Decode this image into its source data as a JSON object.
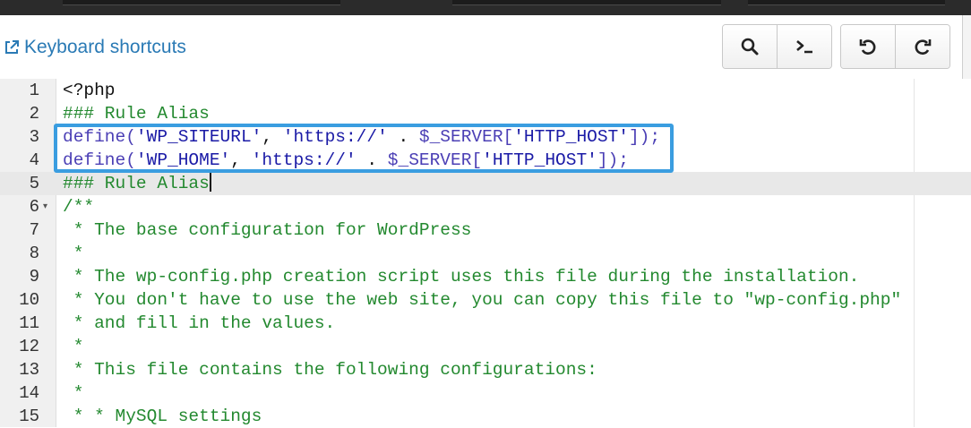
{
  "toolbar": {
    "keyboard_shortcuts_label": "Keyboard shortcuts",
    "icons": [
      "search-icon",
      "terminal-icon",
      "undo-icon",
      "redo-icon"
    ]
  },
  "editor": {
    "lines": [
      {
        "num": "1",
        "tokens": [
          {
            "t": "<?php",
            "c": "plain"
          }
        ]
      },
      {
        "num": "2",
        "tokens": [
          {
            "t": "### Rule Alias",
            "c": "comment"
          }
        ]
      },
      {
        "num": "3",
        "tokens": [
          {
            "t": "define(",
            "c": "kw"
          },
          {
            "t": "'WP_SITEURL'",
            "c": "str"
          },
          {
            "t": ", ",
            "c": "plain"
          },
          {
            "t": "'https://'",
            "c": "str"
          },
          {
            "t": " . ",
            "c": "plain"
          },
          {
            "t": "$_SERVER[",
            "c": "kw"
          },
          {
            "t": "'HTTP_HOST'",
            "c": "str"
          },
          {
            "t": "]);",
            "c": "kw"
          }
        ]
      },
      {
        "num": "4",
        "tokens": [
          {
            "t": "define(",
            "c": "kw"
          },
          {
            "t": "'WP_HOME'",
            "c": "str"
          },
          {
            "t": ", ",
            "c": "plain"
          },
          {
            "t": "'https://'",
            "c": "str"
          },
          {
            "t": " . ",
            "c": "plain"
          },
          {
            "t": "$_SERVER[",
            "c": "kw"
          },
          {
            "t": "'HTTP_HOST'",
            "c": "str"
          },
          {
            "t": "]);",
            "c": "kw"
          }
        ]
      },
      {
        "num": "5",
        "active": true,
        "cursor": true,
        "tokens": [
          {
            "t": "### Rule Alias",
            "c": "comment"
          }
        ]
      },
      {
        "num": "6",
        "fold": "▾",
        "tokens": [
          {
            "t": "/**",
            "c": "comment"
          }
        ]
      },
      {
        "num": "7",
        "tokens": [
          {
            "t": " * The base configuration for WordPress",
            "c": "comment"
          }
        ]
      },
      {
        "num": "8",
        "tokens": [
          {
            "t": " *",
            "c": "comment"
          }
        ]
      },
      {
        "num": "9",
        "tokens": [
          {
            "t": " * The wp-config.php creation script uses this file during the installation.",
            "c": "comment"
          }
        ]
      },
      {
        "num": "10",
        "tokens": [
          {
            "t": " * You don't have to use the web site, you can copy this file to \"wp-config.php\"",
            "c": "comment"
          }
        ]
      },
      {
        "num": "11",
        "tokens": [
          {
            "t": " * and fill in the values.",
            "c": "comment"
          }
        ]
      },
      {
        "num": "12",
        "tokens": [
          {
            "t": " *",
            "c": "comment"
          }
        ]
      },
      {
        "num": "13",
        "tokens": [
          {
            "t": " * This file contains the following configurations:",
            "c": "comment"
          }
        ]
      },
      {
        "num": "14",
        "tokens": [
          {
            "t": " *",
            "c": "comment"
          }
        ]
      },
      {
        "num": "15",
        "tokens": [
          {
            "t": " * * MySQL settings",
            "c": "comment"
          }
        ]
      }
    ]
  },
  "colors": {
    "link": "#2a7ab5",
    "highlight_border": "#3a9de0",
    "comment": "#23892f",
    "keyword": "#4b3fb5",
    "string": "#1a1aa6"
  }
}
